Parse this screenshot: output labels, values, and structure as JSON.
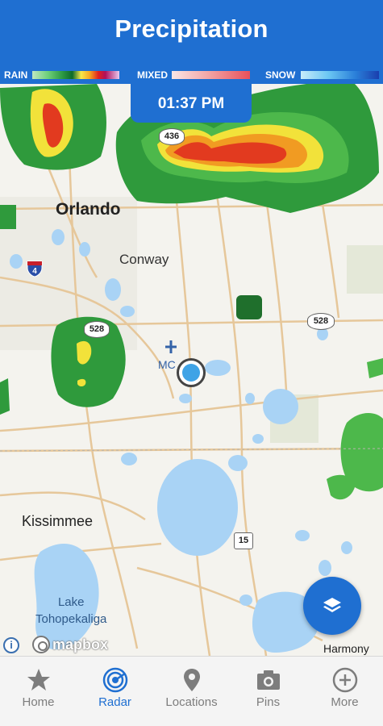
{
  "header": {
    "title": "Precipitation"
  },
  "legend": {
    "rain_label": "RAIN",
    "mixed_label": "MIXED",
    "snow_label": "SNOW"
  },
  "timestamp": "01:37 PM",
  "map": {
    "cities": {
      "orlando": "Orlando",
      "conway": "Conway",
      "kissimmee": "Kissimmee",
      "harmony": "Harmony"
    },
    "lake": {
      "line1": "Lake",
      "line2": "Tohopekaliga"
    },
    "airport_code": "MC",
    "shields": {
      "sr436": "436",
      "sr528_west": "528",
      "sr528_east": "528",
      "us15": "15",
      "i4": "4"
    },
    "attribution": {
      "info": "i",
      "logo": "mapbox"
    }
  },
  "tabs": [
    {
      "label": "Home",
      "icon": "star-icon",
      "active": false
    },
    {
      "label": "Radar",
      "icon": "radar-icon",
      "active": true
    },
    {
      "label": "Locations",
      "icon": "map-pin-icon",
      "active": false
    },
    {
      "label": "Pins",
      "icon": "camera-icon",
      "active": false
    },
    {
      "label": "More",
      "icon": "plus-circle-icon",
      "active": false
    }
  ],
  "colors": {
    "brand": "#1f6fd1",
    "tab_inactive": "#7d7d7d",
    "water": "#a9d3f5",
    "location_dot": "#3fa3e6"
  }
}
